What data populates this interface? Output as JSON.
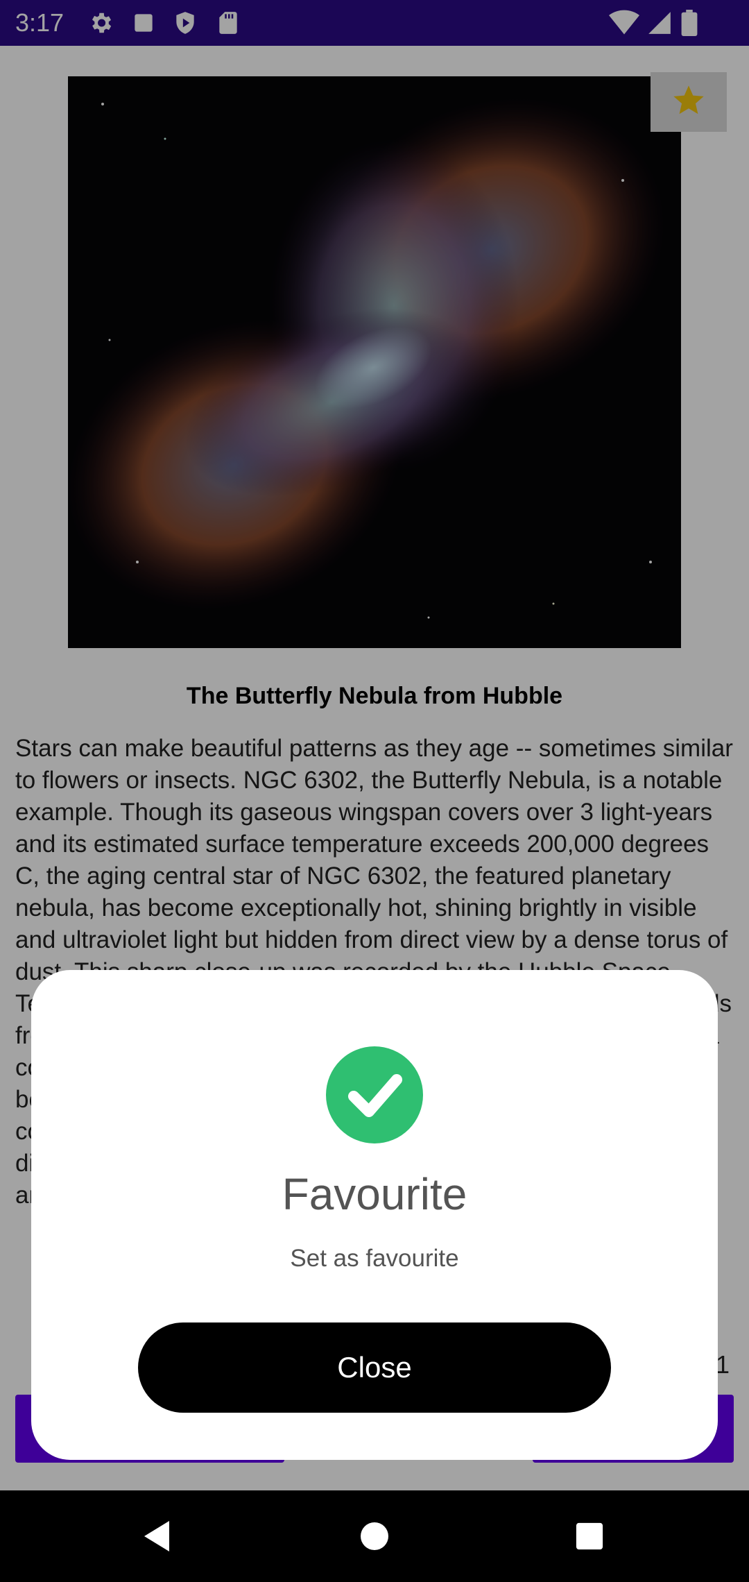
{
  "status_bar": {
    "time": "3:17",
    "icons_left": [
      "gear-icon",
      "square-icon",
      "shield-icon",
      "sd-card-icon"
    ],
    "icons_right": [
      "wifi-icon",
      "signal-icon",
      "battery-icon"
    ],
    "background": "#2b0a86"
  },
  "apod": {
    "image_alt": "Butterfly Nebula",
    "favorite_icon": "star-icon",
    "title": "The Butterfly Nebula from Hubble",
    "description": "Stars can make beautiful patterns as they age -- sometimes similar to flowers or insects. NGC 6302, the Butterfly Nebula, is a notable example.  Though its gaseous wingspan covers over 3 light-years and its estimated surface temperature exceeds 200,000 degrees C, the aging central star of NGC 6302, the featured planetary nebula, has become exceptionally hot, shining brightly in visible and ultraviolet light but hidden from direct view by a dense torus of dust. This sharp close-up was recorded by the Hubble Space Telescope. Particularly striking is the dark lane of dust that extends from the center across the image. The hot central star likely has a companion and the bipolar lobes are likely shaped by interactions between stellar winds and ejected material. The nebula's glow comes from ionized gas, with the colors indicating emission from different elements that help astronomers understand the physics and chemistry of the dying star's environment.",
    "page_number": "1"
  },
  "dialog": {
    "icon": "check-circle-icon",
    "title": "Favourite",
    "message": "Set as favourite",
    "close_label": "Close"
  },
  "nav_bar": {
    "buttons": [
      "back-icon",
      "home-icon",
      "recents-icon"
    ]
  },
  "colors": {
    "accent": "#6200ee",
    "success": "#2fbf71"
  }
}
